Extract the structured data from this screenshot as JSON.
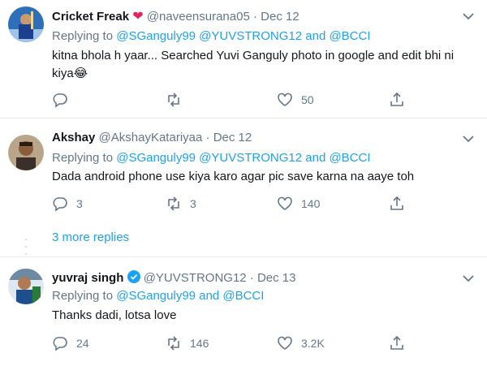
{
  "tweets": [
    {
      "name": "Cricket Freak",
      "handle": "@naveensurana05",
      "sep": "·",
      "date": "Dec 12",
      "replying_prefix": "Replying to",
      "replying_links": "@SGanguly99 @YUVSTRONG12 and @BCCI",
      "text": "kitna bhola h yaar... Searched Yuvi Ganguly photo in google and edit bhi ni kiya😂",
      "reply_count": "",
      "retweet_count": "",
      "like_count": "50",
      "heart_badge_color": "#e0245e"
    },
    {
      "name": "Akshay",
      "handle": "@AkshayKatariyaa",
      "sep": "·",
      "date": "Dec 12",
      "replying_prefix": "Replying to",
      "replying_links": "@SGanguly99 @YUVSTRONG12 and @BCCI",
      "text": "Dada android phone use kiya karo agar pic save karna na aaye toh",
      "reply_count": "3",
      "retweet_count": "3",
      "like_count": "140"
    },
    {
      "name": "yuvraj singh",
      "handle": "@YUVSTRONG12",
      "sep": "·",
      "date": "Dec 13",
      "replying_prefix": "Replying to",
      "replying_links": "@SGanguly99 and @BCCI",
      "text": "Thanks dadi, lotsa love",
      "reply_count": "24",
      "retweet_count": "146",
      "like_count": "3.2K",
      "verified_color": "#1da1f2"
    }
  ],
  "more_replies": "3 more replies",
  "colors": {
    "accent": "#1da1f2",
    "muted": "#657786",
    "text": "#14171a"
  }
}
